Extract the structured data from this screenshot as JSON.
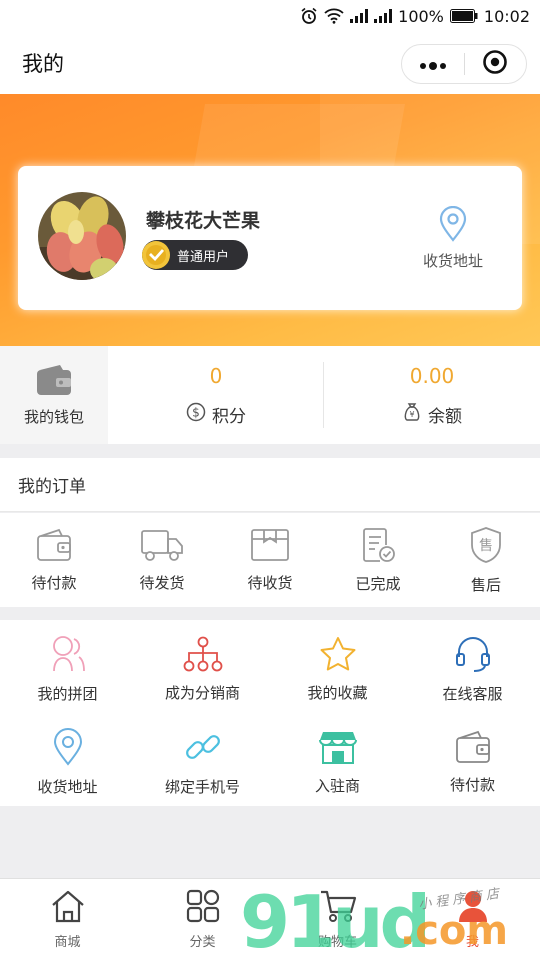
{
  "status_bar": {
    "battery_percent": "100%",
    "time": "10:02"
  },
  "nav": {
    "title": "我的"
  },
  "profile": {
    "username": "攀枝花大芒果",
    "level_badge": "普通用户",
    "address_label": "收货地址"
  },
  "wallet": {
    "label": "我的钱包"
  },
  "stats": [
    {
      "value": "0",
      "label": "积分",
      "icon": "dollar-circle-icon"
    },
    {
      "value": "0.00",
      "label": "余额",
      "icon": "money-bag-icon"
    }
  ],
  "orders": {
    "title": "我的订单",
    "items": [
      {
        "label": "待付款",
        "icon": "wallet-icon"
      },
      {
        "label": "待发货",
        "icon": "truck-icon"
      },
      {
        "label": "待收货",
        "icon": "package-icon"
      },
      {
        "label": "已完成",
        "icon": "checklist-icon"
      },
      {
        "label": "售后",
        "icon": "shield-icon"
      }
    ]
  },
  "services": {
    "row1": [
      {
        "label": "我的拼团",
        "icon": "group-icon",
        "color": "#f0a0b8"
      },
      {
        "label": "成为分销商",
        "icon": "network-icon",
        "color": "#e0504a"
      },
      {
        "label": "我的收藏",
        "icon": "star-icon",
        "color": "#f2b230"
      },
      {
        "label": "在线客服",
        "icon": "headset-icon",
        "color": "#2e6fb8"
      }
    ],
    "row2": [
      {
        "label": "收货地址",
        "icon": "location-icon",
        "color": "#6ab0e0"
      },
      {
        "label": "绑定手机号",
        "icon": "link-icon",
        "color": "#4cc0e0"
      },
      {
        "label": "入驻商",
        "icon": "store-icon",
        "color": "#3cc0a0"
      },
      {
        "label": "待付款",
        "icon": "wallet-icon",
        "color": "#888888"
      }
    ]
  },
  "tabbar": [
    {
      "label": "商城",
      "icon": "home-icon"
    },
    {
      "label": "分类",
      "icon": "grid-icon"
    },
    {
      "label": "购物车",
      "icon": "cart-icon"
    },
    {
      "label": "我",
      "icon": "person-icon"
    }
  ],
  "watermark": {
    "main": "91ud",
    "suffix": ".com",
    "tagline": "小程序商店"
  },
  "colors": {
    "accent": "#f0a830",
    "active_tab": "#e8533a",
    "banner_start": "#ff8a2a",
    "banner_end": "#ffc857"
  }
}
